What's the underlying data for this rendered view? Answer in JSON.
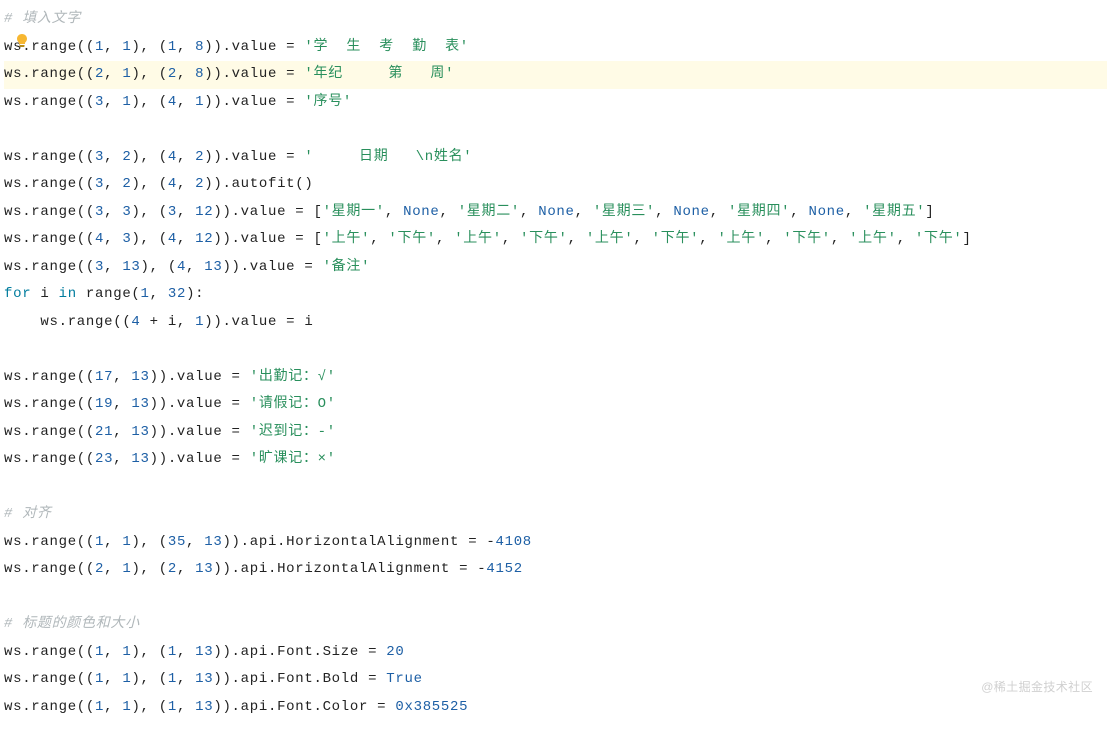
{
  "watermark": "@稀土掘金技术社区",
  "bulb": {
    "name": "lightbulb-icon"
  },
  "lines": [
    {
      "tokens": [
        {
          "t": "# 填入文字",
          "cls": "c"
        }
      ]
    },
    {
      "tokens": [
        {
          "t": "ws.range((",
          "cls": "id"
        },
        {
          "t": "1",
          "cls": "n"
        },
        {
          "t": ", ",
          "cls": "p"
        },
        {
          "t": "1",
          "cls": "n"
        },
        {
          "t": "), (",
          "cls": "p"
        },
        {
          "t": "1",
          "cls": "n"
        },
        {
          "t": ", ",
          "cls": "p"
        },
        {
          "t": "8",
          "cls": "n"
        },
        {
          "t": ")).value = ",
          "cls": "id"
        },
        {
          "t": "'学  生  考  勤  表'",
          "cls": "s"
        }
      ]
    },
    {
      "highlight": true,
      "tokens": [
        {
          "t": "ws.range((",
          "cls": "id"
        },
        {
          "t": "2",
          "cls": "n"
        },
        {
          "t": ", ",
          "cls": "p"
        },
        {
          "t": "1",
          "cls": "n"
        },
        {
          "t": "), (",
          "cls": "p"
        },
        {
          "t": "2",
          "cls": "n"
        },
        {
          "t": ", ",
          "cls": "p"
        },
        {
          "t": "8",
          "cls": "n"
        },
        {
          "t": ")).value = ",
          "cls": "id"
        },
        {
          "t": "'年纪     第   周'",
          "cls": "s"
        }
      ]
    },
    {
      "tokens": [
        {
          "t": "ws.range((",
          "cls": "id"
        },
        {
          "t": "3",
          "cls": "n"
        },
        {
          "t": ", ",
          "cls": "p"
        },
        {
          "t": "1",
          "cls": "n"
        },
        {
          "t": "), (",
          "cls": "p"
        },
        {
          "t": "4",
          "cls": "n"
        },
        {
          "t": ", ",
          "cls": "p"
        },
        {
          "t": "1",
          "cls": "n"
        },
        {
          "t": ")).value = ",
          "cls": "id"
        },
        {
          "t": "'序号'",
          "cls": "s"
        }
      ]
    },
    {
      "blank": true
    },
    {
      "tokens": [
        {
          "t": "ws.range((",
          "cls": "id"
        },
        {
          "t": "3",
          "cls": "n"
        },
        {
          "t": ", ",
          "cls": "p"
        },
        {
          "t": "2",
          "cls": "n"
        },
        {
          "t": "), (",
          "cls": "p"
        },
        {
          "t": "4",
          "cls": "n"
        },
        {
          "t": ", ",
          "cls": "p"
        },
        {
          "t": "2",
          "cls": "n"
        },
        {
          "t": ")).value = ",
          "cls": "id"
        },
        {
          "t": "'     日期   \\n姓名'",
          "cls": "s"
        }
      ]
    },
    {
      "tokens": [
        {
          "t": "ws.range((",
          "cls": "id"
        },
        {
          "t": "3",
          "cls": "n"
        },
        {
          "t": ", ",
          "cls": "p"
        },
        {
          "t": "2",
          "cls": "n"
        },
        {
          "t": "), (",
          "cls": "p"
        },
        {
          "t": "4",
          "cls": "n"
        },
        {
          "t": ", ",
          "cls": "p"
        },
        {
          "t": "2",
          "cls": "n"
        },
        {
          "t": ")).autofit()",
          "cls": "id"
        }
      ]
    },
    {
      "tokens": [
        {
          "t": "ws.range((",
          "cls": "id"
        },
        {
          "t": "3",
          "cls": "n"
        },
        {
          "t": ", ",
          "cls": "p"
        },
        {
          "t": "3",
          "cls": "n"
        },
        {
          "t": "), (",
          "cls": "p"
        },
        {
          "t": "3",
          "cls": "n"
        },
        {
          "t": ", ",
          "cls": "p"
        },
        {
          "t": "12",
          "cls": "n"
        },
        {
          "t": ")).value = [",
          "cls": "id"
        },
        {
          "t": "'星期一'",
          "cls": "s"
        },
        {
          "t": ", ",
          "cls": "p"
        },
        {
          "t": "None",
          "cls": "n"
        },
        {
          "t": ", ",
          "cls": "p"
        },
        {
          "t": "'星期二'",
          "cls": "s"
        },
        {
          "t": ", ",
          "cls": "p"
        },
        {
          "t": "None",
          "cls": "n"
        },
        {
          "t": ", ",
          "cls": "p"
        },
        {
          "t": "'星期三'",
          "cls": "s"
        },
        {
          "t": ", ",
          "cls": "p"
        },
        {
          "t": "None",
          "cls": "n"
        },
        {
          "t": ", ",
          "cls": "p"
        },
        {
          "t": "'星期四'",
          "cls": "s"
        },
        {
          "t": ", ",
          "cls": "p"
        },
        {
          "t": "None",
          "cls": "n"
        },
        {
          "t": ", ",
          "cls": "p"
        },
        {
          "t": "'星期五'",
          "cls": "s"
        },
        {
          "t": "]",
          "cls": "id"
        }
      ]
    },
    {
      "tokens": [
        {
          "t": "ws.range((",
          "cls": "id"
        },
        {
          "t": "4",
          "cls": "n"
        },
        {
          "t": ", ",
          "cls": "p"
        },
        {
          "t": "3",
          "cls": "n"
        },
        {
          "t": "), (",
          "cls": "p"
        },
        {
          "t": "4",
          "cls": "n"
        },
        {
          "t": ", ",
          "cls": "p"
        },
        {
          "t": "12",
          "cls": "n"
        },
        {
          "t": ")).value = [",
          "cls": "id"
        },
        {
          "t": "'上午'",
          "cls": "s"
        },
        {
          "t": ", ",
          "cls": "p"
        },
        {
          "t": "'下午'",
          "cls": "s"
        },
        {
          "t": ", ",
          "cls": "p"
        },
        {
          "t": "'上午'",
          "cls": "s"
        },
        {
          "t": ", ",
          "cls": "p"
        },
        {
          "t": "'下午'",
          "cls": "s"
        },
        {
          "t": ", ",
          "cls": "p"
        },
        {
          "t": "'上午'",
          "cls": "s"
        },
        {
          "t": ", ",
          "cls": "p"
        },
        {
          "t": "'下午'",
          "cls": "s"
        },
        {
          "t": ", ",
          "cls": "p"
        },
        {
          "t": "'上午'",
          "cls": "s"
        },
        {
          "t": ", ",
          "cls": "p"
        },
        {
          "t": "'下午'",
          "cls": "s"
        },
        {
          "t": ", ",
          "cls": "p"
        },
        {
          "t": "'上午'",
          "cls": "s"
        },
        {
          "t": ", ",
          "cls": "p"
        },
        {
          "t": "'下午'",
          "cls": "s"
        },
        {
          "t": "]",
          "cls": "id"
        }
      ]
    },
    {
      "tokens": [
        {
          "t": "ws.range((",
          "cls": "id"
        },
        {
          "t": "3",
          "cls": "n"
        },
        {
          "t": ", ",
          "cls": "p"
        },
        {
          "t": "13",
          "cls": "n"
        },
        {
          "t": "), (",
          "cls": "p"
        },
        {
          "t": "4",
          "cls": "n"
        },
        {
          "t": ", ",
          "cls": "p"
        },
        {
          "t": "13",
          "cls": "n"
        },
        {
          "t": ")).value = ",
          "cls": "id"
        },
        {
          "t": "'备注'",
          "cls": "s"
        }
      ]
    },
    {
      "tokens": [
        {
          "t": "for",
          "cls": "kw"
        },
        {
          "t": " i ",
          "cls": "id"
        },
        {
          "t": "in",
          "cls": "kw"
        },
        {
          "t": " range(",
          "cls": "id"
        },
        {
          "t": "1",
          "cls": "n"
        },
        {
          "t": ", ",
          "cls": "p"
        },
        {
          "t": "32",
          "cls": "n"
        },
        {
          "t": "):",
          "cls": "id"
        }
      ]
    },
    {
      "indent": 1,
      "tokens": [
        {
          "t": "ws.range((",
          "cls": "id"
        },
        {
          "t": "4",
          "cls": "n"
        },
        {
          "t": " + i, ",
          "cls": "id"
        },
        {
          "t": "1",
          "cls": "n"
        },
        {
          "t": ")).value = i",
          "cls": "id"
        }
      ]
    },
    {
      "blank": true
    },
    {
      "tokens": [
        {
          "t": "ws.range((",
          "cls": "id"
        },
        {
          "t": "17",
          "cls": "n"
        },
        {
          "t": ", ",
          "cls": "p"
        },
        {
          "t": "13",
          "cls": "n"
        },
        {
          "t": ")).value = ",
          "cls": "id"
        },
        {
          "t": "'出勤记：√'",
          "cls": "s"
        }
      ]
    },
    {
      "tokens": [
        {
          "t": "ws.range((",
          "cls": "id"
        },
        {
          "t": "19",
          "cls": "n"
        },
        {
          "t": ", ",
          "cls": "p"
        },
        {
          "t": "13",
          "cls": "n"
        },
        {
          "t": ")).value = ",
          "cls": "id"
        },
        {
          "t": "'请假记：O'",
          "cls": "s"
        }
      ]
    },
    {
      "tokens": [
        {
          "t": "ws.range((",
          "cls": "id"
        },
        {
          "t": "21",
          "cls": "n"
        },
        {
          "t": ", ",
          "cls": "p"
        },
        {
          "t": "13",
          "cls": "n"
        },
        {
          "t": ")).value = ",
          "cls": "id"
        },
        {
          "t": "'迟到记：-'",
          "cls": "s"
        }
      ]
    },
    {
      "tokens": [
        {
          "t": "ws.range((",
          "cls": "id"
        },
        {
          "t": "23",
          "cls": "n"
        },
        {
          "t": ", ",
          "cls": "p"
        },
        {
          "t": "13",
          "cls": "n"
        },
        {
          "t": ")).value = ",
          "cls": "id"
        },
        {
          "t": "'旷课记：×'",
          "cls": "s"
        }
      ]
    },
    {
      "blank": true
    },
    {
      "tokens": [
        {
          "t": "# 对齐",
          "cls": "c"
        }
      ]
    },
    {
      "tokens": [
        {
          "t": "ws.range((",
          "cls": "id"
        },
        {
          "t": "1",
          "cls": "n"
        },
        {
          "t": ", ",
          "cls": "p"
        },
        {
          "t": "1",
          "cls": "n"
        },
        {
          "t": "), (",
          "cls": "p"
        },
        {
          "t": "35",
          "cls": "n"
        },
        {
          "t": ", ",
          "cls": "p"
        },
        {
          "t": "13",
          "cls": "n"
        },
        {
          "t": ")).api.HorizontalAlignment = -",
          "cls": "id"
        },
        {
          "t": "4108",
          "cls": "n"
        }
      ]
    },
    {
      "tokens": [
        {
          "t": "ws.range((",
          "cls": "id"
        },
        {
          "t": "2",
          "cls": "n"
        },
        {
          "t": ", ",
          "cls": "p"
        },
        {
          "t": "1",
          "cls": "n"
        },
        {
          "t": "), (",
          "cls": "p"
        },
        {
          "t": "2",
          "cls": "n"
        },
        {
          "t": ", ",
          "cls": "p"
        },
        {
          "t": "13",
          "cls": "n"
        },
        {
          "t": ")).api.HorizontalAlignment = -",
          "cls": "id"
        },
        {
          "t": "4152",
          "cls": "n"
        }
      ]
    },
    {
      "blank": true
    },
    {
      "tokens": [
        {
          "t": "# 标题的颜色和大小",
          "cls": "c"
        }
      ]
    },
    {
      "tokens": [
        {
          "t": "ws.range((",
          "cls": "id"
        },
        {
          "t": "1",
          "cls": "n"
        },
        {
          "t": ", ",
          "cls": "p"
        },
        {
          "t": "1",
          "cls": "n"
        },
        {
          "t": "), (",
          "cls": "p"
        },
        {
          "t": "1",
          "cls": "n"
        },
        {
          "t": ", ",
          "cls": "p"
        },
        {
          "t": "13",
          "cls": "n"
        },
        {
          "t": ")).api.Font.Size = ",
          "cls": "id"
        },
        {
          "t": "20",
          "cls": "n"
        }
      ]
    },
    {
      "tokens": [
        {
          "t": "ws.range((",
          "cls": "id"
        },
        {
          "t": "1",
          "cls": "n"
        },
        {
          "t": ", ",
          "cls": "p"
        },
        {
          "t": "1",
          "cls": "n"
        },
        {
          "t": "), (",
          "cls": "p"
        },
        {
          "t": "1",
          "cls": "n"
        },
        {
          "t": ", ",
          "cls": "p"
        },
        {
          "t": "13",
          "cls": "n"
        },
        {
          "t": ")).api.Font.Bold = ",
          "cls": "id"
        },
        {
          "t": "True",
          "cls": "n"
        }
      ]
    },
    {
      "tokens": [
        {
          "t": "ws.range((",
          "cls": "id"
        },
        {
          "t": "1",
          "cls": "n"
        },
        {
          "t": ", ",
          "cls": "p"
        },
        {
          "t": "1",
          "cls": "n"
        },
        {
          "t": "), (",
          "cls": "p"
        },
        {
          "t": "1",
          "cls": "n"
        },
        {
          "t": ", ",
          "cls": "p"
        },
        {
          "t": "13",
          "cls": "n"
        },
        {
          "t": ")).api.Font.Color = ",
          "cls": "id"
        },
        {
          "t": "0x385525",
          "cls": "n"
        }
      ]
    }
  ]
}
